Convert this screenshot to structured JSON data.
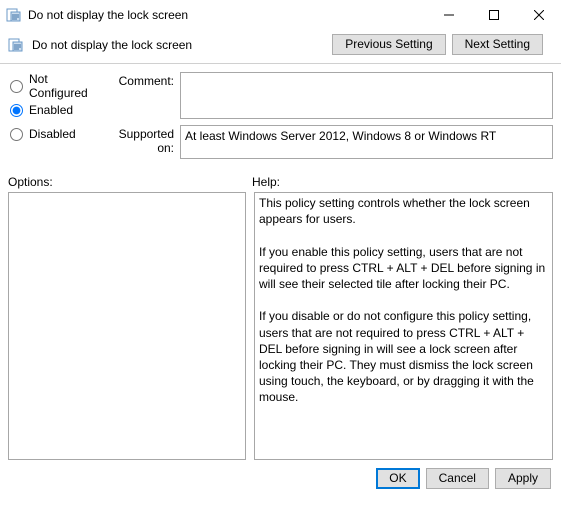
{
  "window": {
    "title": "Do not display the lock screen",
    "subtitle": "Do not display the lock screen"
  },
  "nav": {
    "previous": "Previous Setting",
    "next": "Next Setting"
  },
  "radios": {
    "not_configured": "Not Configured",
    "enabled": "Enabled",
    "disabled": "Disabled",
    "selected": "enabled"
  },
  "labels": {
    "comment": "Comment:",
    "supported_on": "Supported on:",
    "options": "Options:",
    "help": "Help:"
  },
  "values": {
    "comment": "",
    "supported_on": "At least Windows Server 2012, Windows 8 or Windows RT",
    "options": "",
    "help": "This policy setting controls whether the lock screen appears for users.\n\nIf you enable this policy setting, users that are not required to press CTRL + ALT + DEL before signing in will see their selected tile after locking their PC.\n\nIf you disable or do not configure this policy setting, users that are not required to press CTRL + ALT + DEL before signing in will see a lock screen after locking their PC. They must dismiss the lock screen using touch, the keyboard, or by dragging it with the mouse."
  },
  "footer": {
    "ok": "OK",
    "cancel": "Cancel",
    "apply": "Apply"
  }
}
